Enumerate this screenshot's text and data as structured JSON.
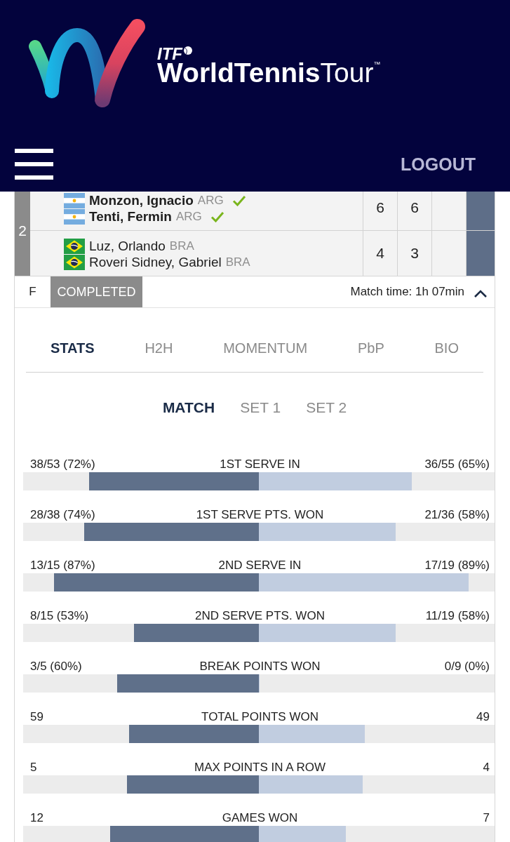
{
  "header": {
    "logo": {
      "mark": "ITF",
      "wordmark": "**WorldTennis**Tour$^{™}$"
    },
    "logout": "LOGOUT"
  },
  "match": {
    "label": "2",
    "teams": [
      {
        "winner": true,
        "scores": [
          "6",
          "6"
        ],
        "players": [
          {
            "kind": "argentina",
            "name": "Monzon, Ignacio",
            "country": "ARG"
          },
          {
            "kind": "argentina",
            "name": "Tenti, Fermin",
            "country": "ARG"
          }
        ]
      },
      {
        "winner": false,
        "scores": [
          "4",
          "3"
        ],
        "players": [
          {
            "kind": "brazil",
            "name": "Luz, Orlando",
            "country": "BRA"
          },
          {
            "kind": "brazil",
            "name": "Roveri Sidney, Gabriel",
            "country": "BRA"
          }
        ]
      }
    ],
    "round": "F",
    "status": "COMPLETED",
    "match_time": "Match time: 1h 07min",
    "expanded": true
  },
  "tabs": [
    {
      "label": "STATS",
      "selected": true
    },
    {
      "label": "H2H",
      "selected": false
    },
    {
      "label": "MOMENTUM",
      "selected": false
    },
    {
      "label": "PbP",
      "selected": false
    },
    {
      "label": "BIO",
      "selected": false
    }
  ],
  "periods": [
    {
      "label": "MATCH",
      "selected": true
    },
    {
      "label": "SET 1",
      "selected": false
    },
    {
      "label": "SET 2",
      "selected": false
    }
  ],
  "stats": [
    {
      "label": "1ST SERVE IN",
      "left": {
        "value": "38/53 (72%)",
        "level": 0.72
      },
      "right": {
        "value": "36/55 (65%)",
        "level": 0.65
      }
    },
    {
      "label": "1ST SERVE PTS. WON",
      "left": {
        "value": "28/38 (74%)",
        "level": 0.74
      },
      "right": {
        "value": "21/36 (58%)",
        "level": 0.58
      }
    },
    {
      "label": "2ND SERVE IN",
      "left": {
        "value": "13/15 (87%)",
        "level": 0.87
      },
      "right": {
        "value": "17/19 (89%)",
        "level": 0.89
      }
    },
    {
      "label": "2ND SERVE PTS. WON",
      "left": {
        "value": "8/15 (53%)",
        "level": 0.53
      },
      "right": {
        "value": "11/19 (58%)",
        "level": 0.58
      }
    },
    {
      "label": "BREAK POINTS WON",
      "left": {
        "value": "3/5 (60%)",
        "level": 0.6
      },
      "right": {
        "value": "0/9 (0%)",
        "level": 0
      }
    },
    {
      "label": "TOTAL POINTS WON",
      "left": {
        "value": "59",
        "level": 0.55
      },
      "right": {
        "value": "49",
        "level": 0.45
      }
    },
    {
      "label": "MAX POINTS IN A ROW",
      "left": {
        "value": "5",
        "level": 0.56
      },
      "right": {
        "value": "4",
        "level": 0.44
      }
    },
    {
      "label": "GAMES WON",
      "left": {
        "value": "12",
        "level": 0.63
      },
      "right": {
        "value": "7",
        "level": 0.37
      }
    }
  ]
}
